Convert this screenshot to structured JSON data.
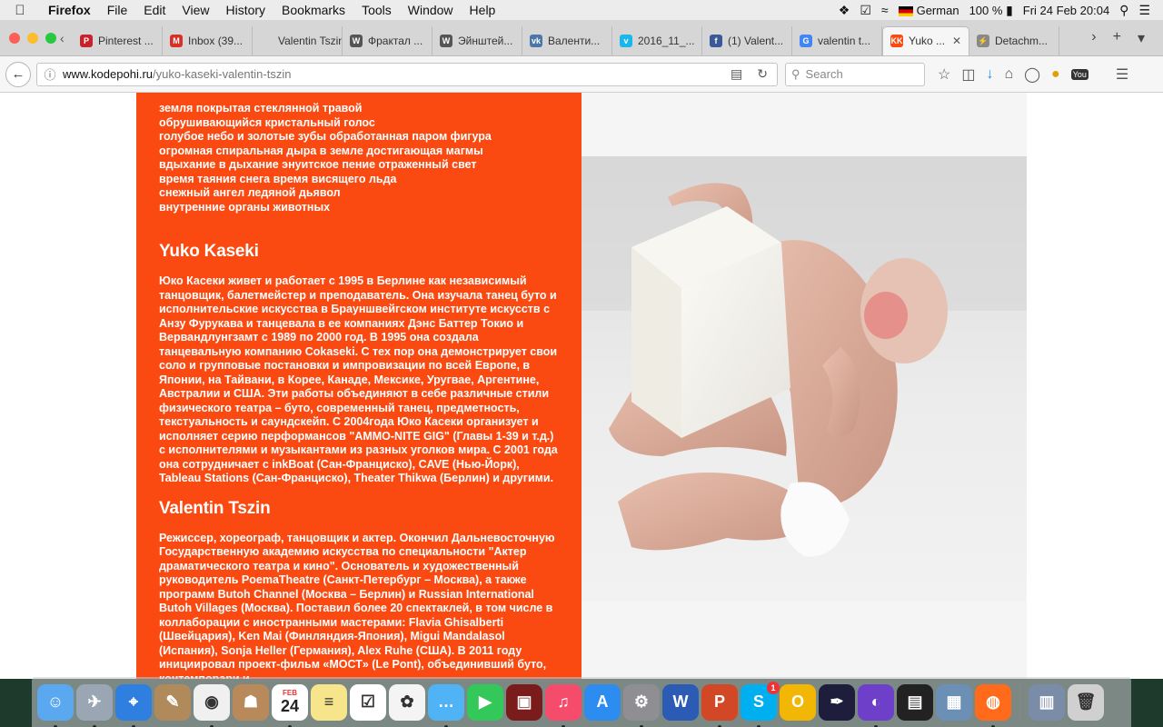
{
  "menubar": {
    "app": "Firefox",
    "items": [
      "File",
      "Edit",
      "View",
      "History",
      "Bookmarks",
      "Tools",
      "Window",
      "Help"
    ],
    "input_source": "German",
    "battery": "100 %",
    "datetime": "Fri 24 Feb  20:04"
  },
  "tabs": [
    {
      "label": "Pinterest ...",
      "fav": "P",
      "color": "#c8232c"
    },
    {
      "label": "Inbox (39...",
      "fav": "M",
      "color": "#d93025"
    },
    {
      "label": "Valentin Tszin",
      "fav": "",
      "color": "#d6d6d6"
    },
    {
      "label": "Фрактал ...",
      "fav": "W",
      "color": "#555555"
    },
    {
      "label": "Эйнштей...",
      "fav": "W",
      "color": "#555555"
    },
    {
      "label": "Валенти...",
      "fav": "vk",
      "color": "#4a76a8"
    },
    {
      "label": "2016_11_...",
      "fav": "v",
      "color": "#1ab7ea"
    },
    {
      "label": "(1) Valent...",
      "fav": "f",
      "color": "#3b5998"
    },
    {
      "label": "valentin t...",
      "fav": "G",
      "color": "#4285f4"
    },
    {
      "label": "Yuko ...",
      "fav": "KK",
      "color": "#fa4a12",
      "active": true
    },
    {
      "label": "Detachm...",
      "fav": "⚡",
      "color": "#888888"
    }
  ],
  "navbar": {
    "url_host": "www.kodepohi.ru",
    "url_path": "/yuko-kaseki-valentin-tszin",
    "search_placeholder": "Search"
  },
  "page": {
    "poem_lines": [
      "земля покрытая стеклянной травой",
      "обрушивающийся кристальный голос",
      "голубое небо и золотые зубы обработанная паром фигура",
      "огромная спиральная дыра в земле достигающая магмы",
      "вдыхание в дыхание энуитское пение отраженный свет",
      "время таяния снега время висящего льда",
      "снежный ангел ледяной дьявол",
      "внутренние органы животных"
    ],
    "heading1": "Yuko Kaseki",
    "bio1": "Юко Касеки живет и работает с 1995 в Берлине как независимый танцовщик, балетмейстер и преподаватель. Она изучала танец буто и исполнительские искусства в Брауншвейгском институте искусств с Анзу Фурукава и танцевала в ее компаниях Дэнс Баттер Токио и Вервандлунгзамт с 1989 по 2000 год. В 1995 она создала танцевальную компанию Cokaseki. С тех пор она демонстрирует свои соло и групповые постановки и импровизации по всей Европе, в Японии, на Тайвани, в Корее, Канаде, Мексике, Уругвае, Аргентине, Австралии и США. Эти работы объединяют в себе различные стили физического театра – буто, современный танец, предметность, текстуальность и саундскейп. С 2004года Юко Касеки организует и исполняет серию перформансов \"AMMO-NITE GIG\" (Главы 1-39 и т.д.) с исполнителями и музыкантами из разных уголков мира. С 2001 года она сотрудничает с inkBoat (Сан-Франциско), CAVE (Нью-Йорк), Tableau Stations (Сан-Франциско), Theater Thikwa (Берлин) и другими.",
    "heading2": "Valentin Tszin",
    "bio2": "Режиссер, хореограф, танцовщик и актер. Окончил Дальневосточную Государственную академию искусства по специальности \"Актер драматического театра и кино\". Основатель и художественный руководитель PoemaTheatre (Санкт-Петербург – Москва), а также программ Butoh Channel (Москва – Берлин) и Russian International Butoh Villages (Москва). Поставил более 20 спектаклей, в том числе в коллаборации с иностранными мастерами: Flavia Ghisalberti (Швейцария), Ken Mai (Финляндия-Япония), Migui Mandalasol (Испания), Sonja Heller (Германия), Alex Ruhe (США). В 2011 году инициировал проект-фильм «МОСТ» (Le Pont), объединивший буто, контемпорари и"
  },
  "dock": {
    "calendar_month": "FEB",
    "calendar_day": "24",
    "skype_badge": "1",
    "apps": [
      "Finder",
      "Launchpad",
      "Safari",
      "Preview",
      "Chrome",
      "Contacts",
      "Calendar",
      "Notes",
      "Reminders",
      "Photos",
      "Messages",
      "FaceTime",
      "Photo Booth",
      "iTunes",
      "App Store",
      "System Preferences",
      "Word",
      "PowerPoint",
      "Skype",
      "Opus",
      "Inkscape",
      "GitHub",
      "Final Cut",
      "Image Capture",
      "Firefox",
      "Downloads",
      "Trash"
    ]
  }
}
